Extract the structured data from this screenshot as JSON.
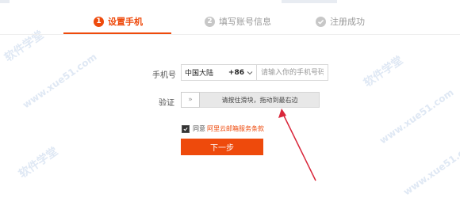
{
  "steps": [
    {
      "number": "1",
      "label": "设置手机"
    },
    {
      "number": "2",
      "label": "填写账号信息"
    },
    {
      "label": "注册成功"
    }
  ],
  "form": {
    "phone_label": "手机号",
    "country": "中国大陆",
    "country_code": "+86",
    "phone_placeholder": "请输入你的手机号码",
    "verify_label": "验证",
    "slider_handle": "»",
    "slider_text": "请按住滑块，拖动到最右边",
    "agree_text": "同意",
    "agree_link": "阿里云邮箱服务条款",
    "agree_checked": true,
    "next_button": "下一步"
  },
  "watermarks": [
    "软件学堂",
    "www.xue51.com"
  ],
  "colors": {
    "accent": "#ee4a0c",
    "annotation_arrow": "#d9263a"
  }
}
